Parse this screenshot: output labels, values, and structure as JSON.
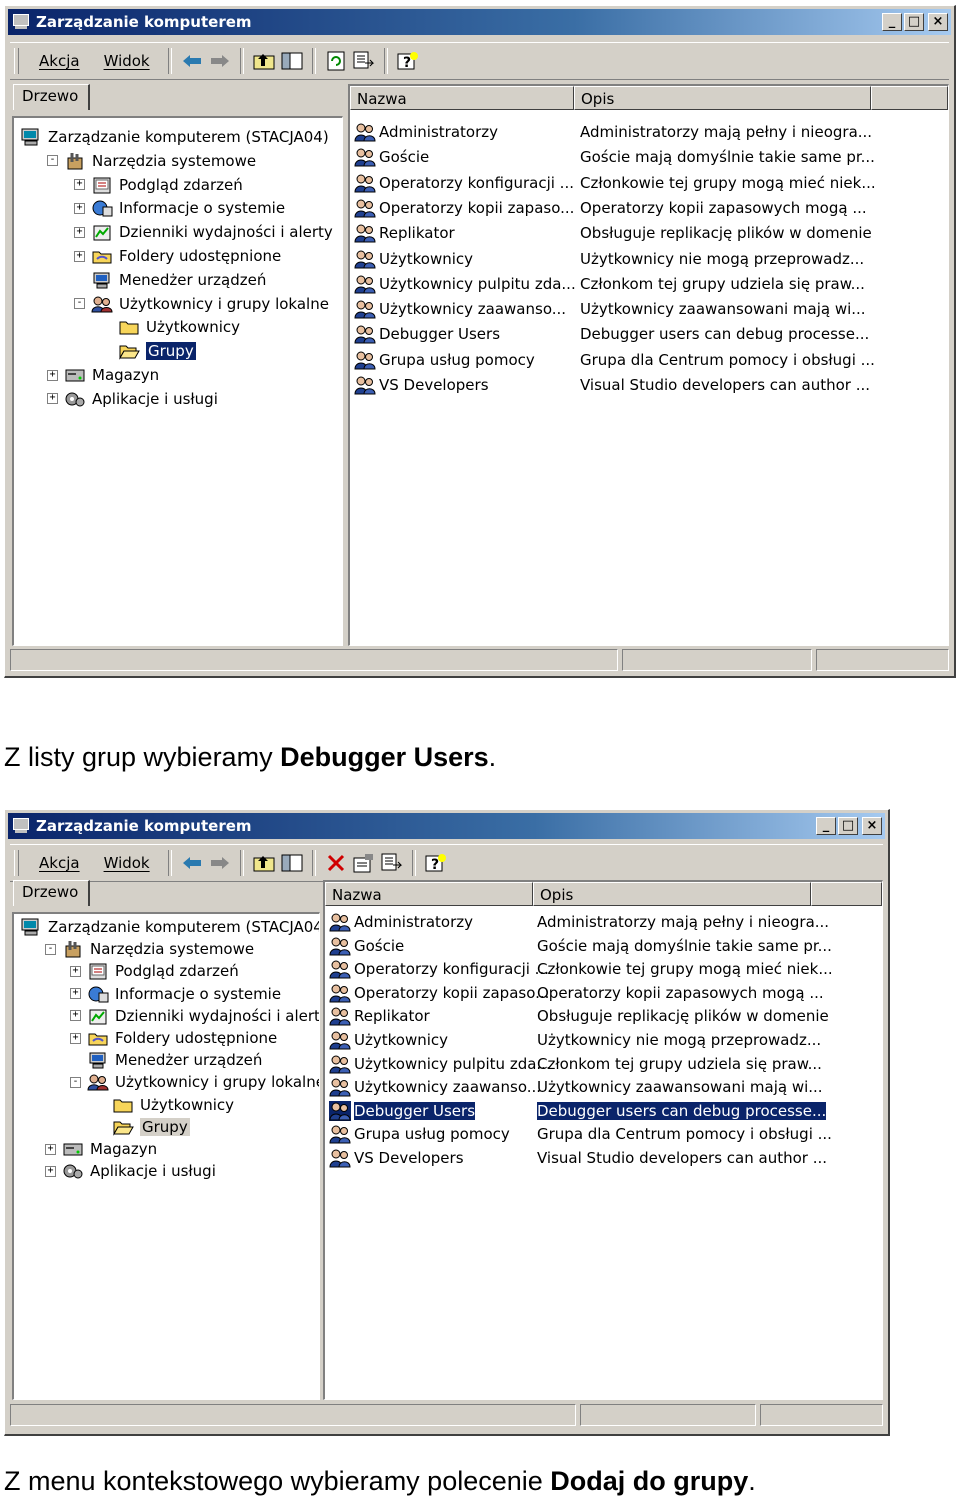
{
  "window_title": "Zarządzanie komputerem",
  "menu": {
    "akcja": "Akcja",
    "widok": "Widok"
  },
  "tree_tab": "Drzewo",
  "columns": {
    "name": "Nazwa",
    "desc": "Opis"
  },
  "tree": [
    {
      "label": "Zarządzanie komputerem (STACJA04)",
      "icon": "computer-management-icon"
    },
    {
      "label": "Narzędzia systemowe",
      "icon": "system-tools-icon"
    },
    {
      "label": "Podgląd zdarzeń",
      "icon": "event-viewer-icon"
    },
    {
      "label": "Informacje o systemie",
      "icon": "system-info-icon"
    },
    {
      "label": "Dzienniki wydajności i alerty",
      "icon": "performance-logs-icon"
    },
    {
      "label": "Foldery udostępnione",
      "icon": "shared-folders-icon"
    },
    {
      "label": "Menedżer urządzeń",
      "icon": "device-manager-icon"
    },
    {
      "label": "Użytkownicy i grupy lokalne",
      "icon": "local-users-groups-icon"
    },
    {
      "label": "Użytkownicy",
      "icon": "folder-icon"
    },
    {
      "label": "Grupy",
      "icon": "folder-open-icon"
    },
    {
      "label": "Magazyn",
      "icon": "storage-icon"
    },
    {
      "label": "Aplikacje i usługi",
      "icon": "services-apps-icon"
    }
  ],
  "groups": [
    {
      "name": "Administratorzy",
      "desc": "Administratorzy mają pełny i nieogra..."
    },
    {
      "name": "Goście",
      "desc": "Goście mają domyślnie takie same pr..."
    },
    {
      "name": "Operatorzy konfiguracji ...",
      "desc": "Członkowie tej grupy mogą mieć niek..."
    },
    {
      "name": "Operatorzy kopii zapaso...",
      "desc": "Operatorzy kopii zapasowych mogą ..."
    },
    {
      "name": "Replikator",
      "desc": "Obsługuje replikację plików w domenie"
    },
    {
      "name": "Użytkownicy",
      "desc": "Użytkownicy nie mogą przeprowadz..."
    },
    {
      "name": "Użytkownicy pulpitu zda...",
      "desc": "Członkom tej grupy udziela się praw..."
    },
    {
      "name": "Użytkownicy zaawanso...",
      "desc": "Użytkownicy zaawansowani mają wi..."
    },
    {
      "name": "Debugger Users",
      "desc": "Debugger users can debug processe..."
    },
    {
      "name": "Grupa usług pomocy",
      "desc": "Grupa dla Centrum pomocy i obsługi ..."
    },
    {
      "name": "VS Developers",
      "desc": "Visual Studio developers can author ..."
    }
  ],
  "caption1": {
    "prefix": "Z listy grup wybieramy ",
    "bold": "Debugger Users",
    "suffix": "."
  },
  "caption2": {
    "prefix": "Z menu kontekstowego wybieramy polecenie ",
    "bold": "Dodaj do grupy",
    "suffix": "."
  },
  "colors": {
    "title_active": "#0a246a",
    "face": "#d4d0c8",
    "selection": "#0a246a"
  }
}
